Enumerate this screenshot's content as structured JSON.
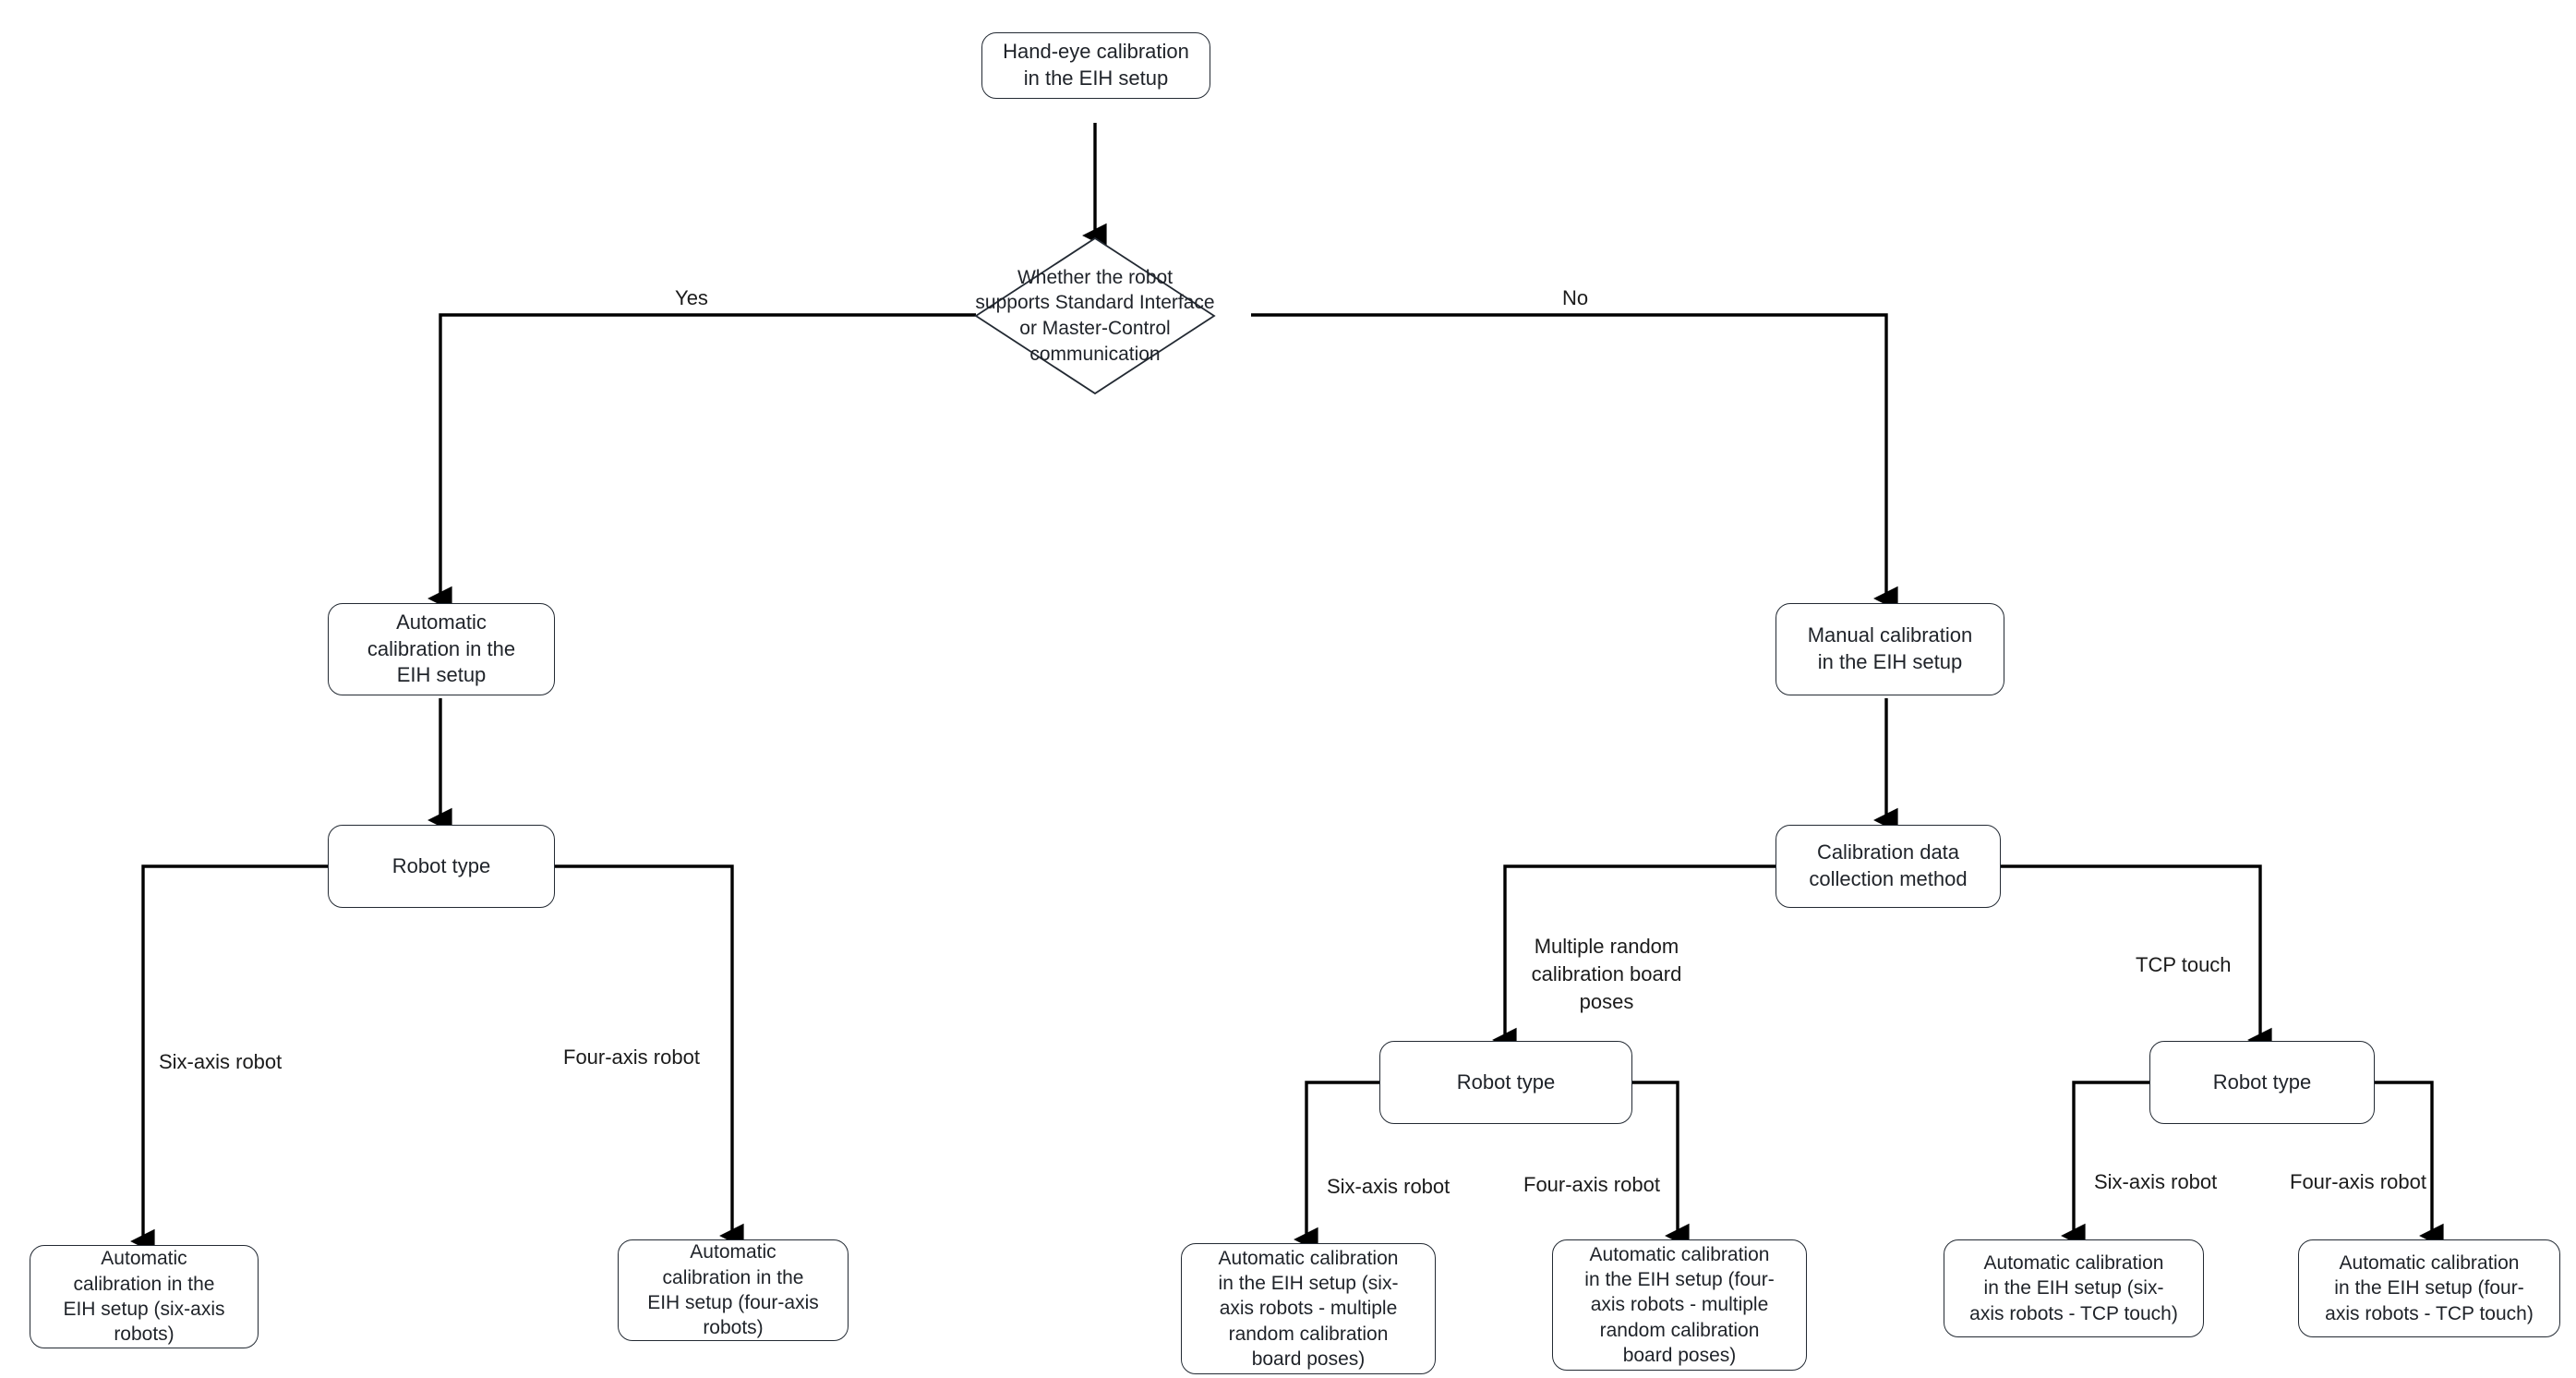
{
  "diagram": {
    "type": "flowchart",
    "title": "Hand-eye calibration in the EIH setup",
    "background_color": "#ffffff",
    "node_stroke_color": "#232a33",
    "text_color": "#1f2329",
    "edge_color": "#000000",
    "nodes": {
      "start": "Hand-eye calibration\nin the EIH setup",
      "decision_comm": "Whether the robot\nsupports Standard Interface\nor Master-Control\ncommunication",
      "auto_calib": "Automatic\ncalibration in the\nEIH setup",
      "manual_calib": "Manual calibration\nin the EIH setup",
      "robot_type_auto": "Robot type",
      "collection_method": "Calibration data\ncollection method",
      "robot_type_random": "Robot type",
      "robot_type_tcp": "Robot type",
      "leaf_auto_six": "Automatic\ncalibration in the\nEIH setup (six-axis\nrobots)",
      "leaf_auto_four": "Automatic\ncalibration in the\nEIH setup (four-axis\nrobots)",
      "leaf_random_six": "Automatic calibration\nin the EIH setup (six-\naxis robots - multiple\nrandom calibration\nboard poses)",
      "leaf_random_four": "Automatic calibration\nin the EIH setup (four-\naxis robots - multiple\nrandom calibration\nboard poses)",
      "leaf_tcp_six": "Automatic calibration\nin the EIH setup (six-\naxis robots - TCP touch)",
      "leaf_tcp_four": "Automatic calibration\nin the EIH setup (four-\naxis robots - TCP touch)"
    },
    "edge_labels": {
      "yes": "Yes",
      "no": "No",
      "six_axis_auto": "Six-axis robot",
      "four_axis_auto": "Four-axis robot",
      "multiple_random": "Multiple random\ncalibration board\nposes",
      "tcp_touch": "TCP touch",
      "six_axis_random": "Six-axis robot",
      "four_axis_random": "Four-axis robot",
      "six_axis_tcp": "Six-axis robot",
      "four_axis_tcp": "Four-axis robot"
    }
  }
}
